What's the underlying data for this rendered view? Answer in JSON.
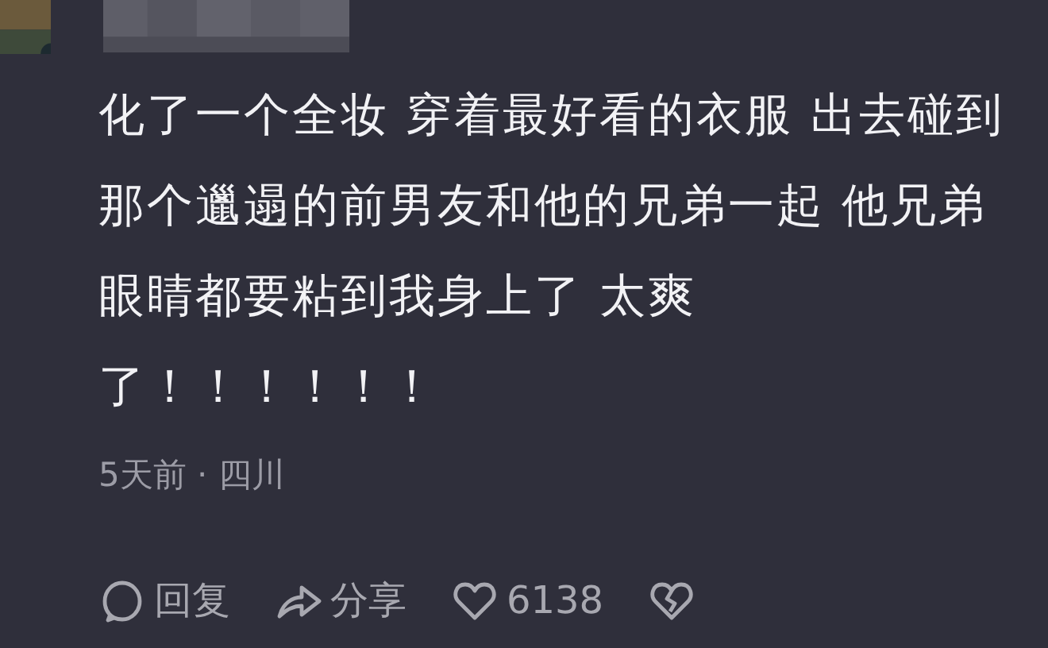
{
  "comment": {
    "text": "化了一个全妆 穿着最好看的衣服 出去碰到那个邋遢的前男友和他的兄弟一起 他兄弟眼睛都要粘到我身上了 太爽了！！！！！！",
    "meta": "5天前 · 四川",
    "actions": [
      {
        "kind": "reply",
        "label": "回复"
      },
      {
        "kind": "share",
        "label": "分享"
      },
      {
        "kind": "like",
        "label": "6138"
      },
      {
        "kind": "dislike"
      }
    ]
  }
}
